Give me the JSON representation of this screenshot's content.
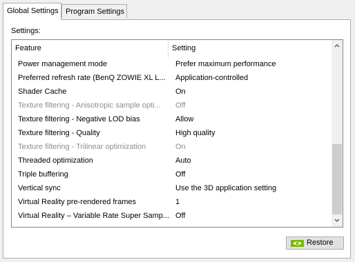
{
  "tabs": [
    {
      "label": "Global Settings"
    },
    {
      "label": "Program Settings"
    }
  ],
  "settings_label": "Settings:",
  "columns": {
    "feature": "Feature",
    "setting": "Setting"
  },
  "rows": [
    {
      "feature": "Power management mode",
      "setting": "Prefer maximum performance"
    },
    {
      "feature": "Preferred refresh rate (BenQ ZOWIE XL L...",
      "setting": "Application-controlled"
    },
    {
      "feature": "Shader Cache",
      "setting": "On"
    },
    {
      "feature": "Texture filtering - Anisotropic sample opti...",
      "setting": "Off"
    },
    {
      "feature": "Texture filtering - Negative LOD bias",
      "setting": "Allow"
    },
    {
      "feature": "Texture filtering - Quality",
      "setting": "High quality"
    },
    {
      "feature": "Texture filtering - Trilinear optimization",
      "setting": "On"
    },
    {
      "feature": "Threaded optimization",
      "setting": "Auto"
    },
    {
      "feature": "Triple buffering",
      "setting": "Off"
    },
    {
      "feature": "Vertical sync",
      "setting": "Use the 3D application setting"
    },
    {
      "feature": "Virtual Reality pre-rendered frames",
      "setting": "1"
    },
    {
      "feature": "Virtual Reality – Variable Rate Super Samp...",
      "setting": "Off"
    }
  ],
  "restore_button": {
    "label": "Restore",
    "icon": "nvidia-logo-icon"
  },
  "colors": {
    "disabled_text": "#8d8d8d",
    "nvidia_green": "#76b900"
  }
}
